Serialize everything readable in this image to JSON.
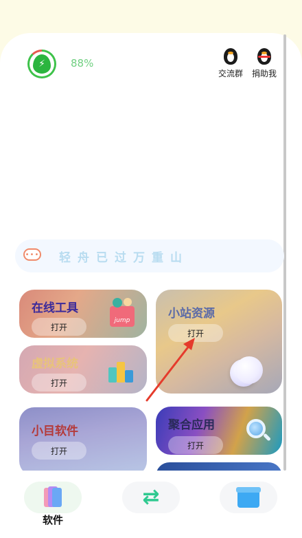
{
  "status": {
    "battery_percent": "88%"
  },
  "top_actions": {
    "group_label": "交流群",
    "donate_label": "捐助我"
  },
  "motto": {
    "text": "轻舟已过万重山"
  },
  "cards": {
    "online_tools": {
      "title": "在线工具",
      "open": "打开",
      "badge": "jump"
    },
    "virtual_system": {
      "title": "虚拟系统",
      "open": "打开"
    },
    "site_resources": {
      "title": "小站资源",
      "open": "打开"
    },
    "mini_software": {
      "title": "小目软件",
      "open": "打开"
    },
    "aggregate_apps": {
      "title": "聚合应用",
      "open": "打开"
    }
  },
  "bottom_nav": {
    "software_label": "软件"
  },
  "colors": {
    "background": "#fdfbe6",
    "battery_green": "#3ec24a",
    "switch_green": "#2fc990",
    "annotation_red": "#e53b2c"
  }
}
